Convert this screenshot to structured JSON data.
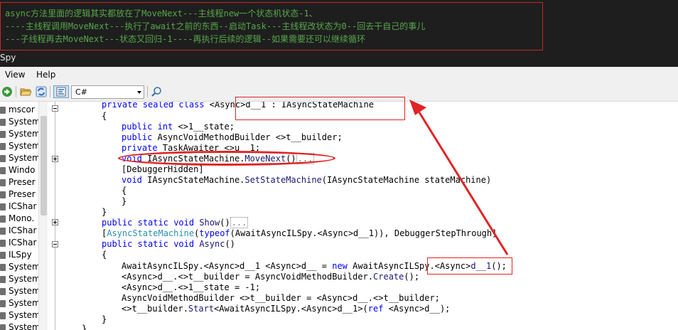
{
  "annotation": {
    "lines": [
      "async方法里面的逻辑其实都放在了MoveNext---主线程new一个状态机状态-1、",
      "----主线程调用MoveNext---执行了await之前的东西--启动Task---主线程改状态为0--回去干自己的事儿",
      "---子线程再去MoveNext---状态又回归-1----再执行后续的逻辑--如果需要还可以继续循环"
    ],
    "color": "#57a64a",
    "border_color": "#c82828"
  },
  "app_title": "Spy",
  "menu": {
    "view": "View",
    "help": "Help"
  },
  "toolbar": {
    "language": "C#",
    "icons": [
      "back-icon",
      "open-icon",
      "refresh-icon",
      "decompile-icon",
      "search-icon"
    ]
  },
  "tree": {
    "items": [
      "mscor",
      "System",
      "System",
      "System",
      "System",
      "Windo",
      "Preser",
      "Preser",
      "ICShar",
      "Mono.",
      "ICShar",
      "ICShar",
      "ILSpy",
      "System",
      "System",
      "System",
      "System",
      "System",
      "System"
    ]
  },
  "code": {
    "l1": {
      "a": "private",
      "b": " ",
      "c": "sealed",
      "d": " ",
      "e": "class",
      "f": " <Async>d__1 : IAsyncStateMachine"
    },
    "l2": "{",
    "l3": {
      "a": "public",
      "b": " ",
      "c": "int",
      "d": " <>1__state;"
    },
    "l4": {
      "a": "public",
      "b": " AsyncVoidMethodBuilder <>t__builder;"
    },
    "l5": {
      "a": "private",
      "b": " TaskAwaiter <>u__1;"
    },
    "l6": {
      "a": "void",
      "b": " IAsyncStateMachine.",
      "c": "MoveNext",
      "d": "()",
      "e": "..."
    },
    "l7": "[DebuggerHidden]",
    "l8": {
      "a": "void",
      "b": " IAsyncStateMachine.",
      "c": "SetStateMachine",
      "d": "(IAsyncStateMachine stateMachine)"
    },
    "l9": "{",
    "l10": "}",
    "l11": "}",
    "l12": {
      "a": "public",
      "b": " ",
      "c": "static",
      "d": " ",
      "e": "void",
      "f": " ",
      "g": "Show",
      "h": "()",
      "i": "..."
    },
    "l13": {
      "a": "[",
      "b": "AsyncStateMachine",
      "c": "(",
      "d": "typeof",
      "e": "(AwaitAsyncILSpy.<Async>d__1)), DebuggerStepThrough]"
    },
    "l14": {
      "a": "public",
      "b": " ",
      "c": "static",
      "d": " ",
      "e": "void",
      "f": " ",
      "g": "Async",
      "h": "()"
    },
    "l15": "{",
    "l16": {
      "a": "AwaitAsyncILSpy.<Async>d__1 <Async>d__ = ",
      "b": "new",
      "c": " AwaitAsyncILSpy.",
      "d": "<Async>",
      "e": "d__1",
      "f": "();"
    },
    "l17": {
      "a": "<Async>d__.<>t__builder = AsyncVoidMethodBuilder.",
      "b": "Create",
      "c": "();"
    },
    "l18": "<Async>d__.<>1__state = -1;",
    "l19": "AsyncVoidMethodBuilder <>t__builder = <Async>d__.<>t__builder;",
    "l20": {
      "a": "<>t__builder.",
      "b": "Start",
      "c": "<AwaitAsyncILSpy.<Async>d__1>(",
      "d": "ref",
      "e": " <Async>d__);"
    },
    "l21": "}",
    "l22": "}"
  },
  "colors": {
    "keyword": "#0000ff",
    "annotation_red": "#e02424",
    "background_dark": "#1e1e1e"
  }
}
